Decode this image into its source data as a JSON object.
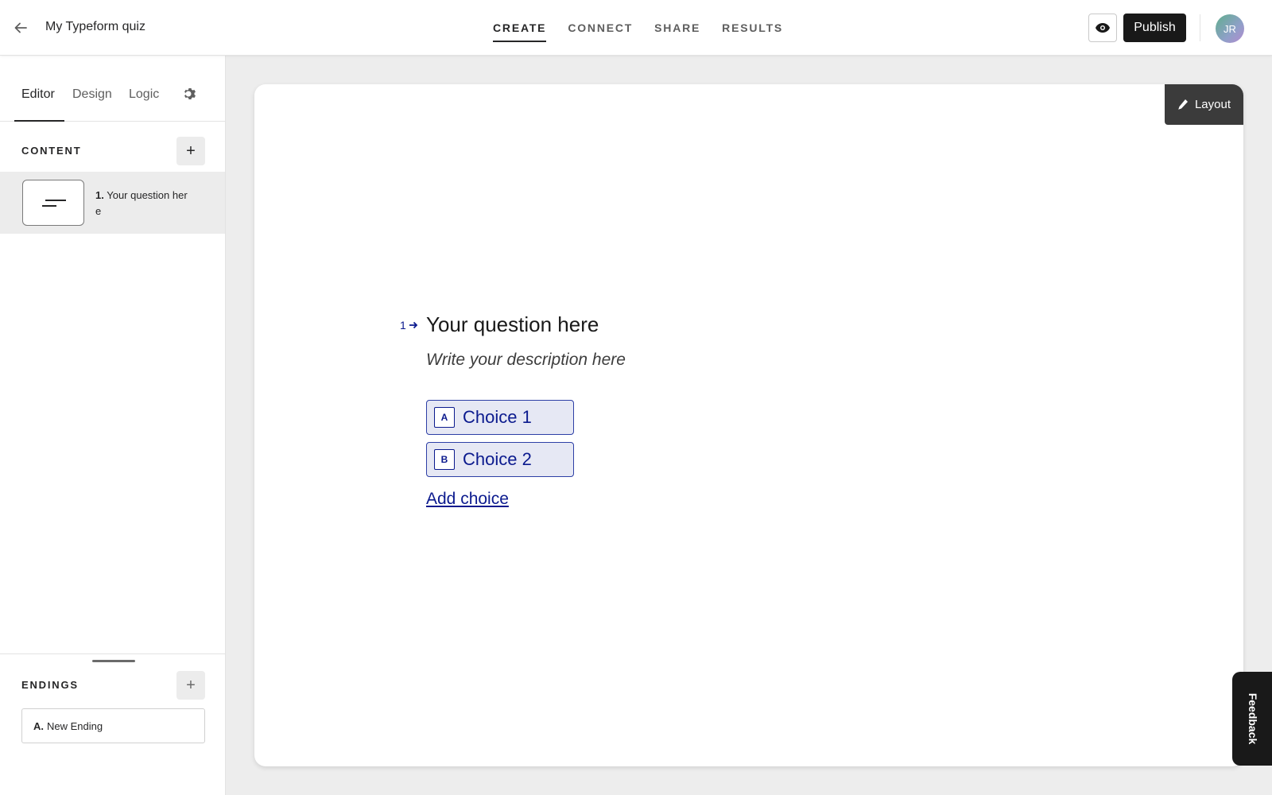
{
  "header": {
    "form_title": "My Typeform quiz",
    "tabs": [
      {
        "label": "CREATE",
        "active": true
      },
      {
        "label": "CONNECT",
        "active": false
      },
      {
        "label": "SHARE",
        "active": false
      },
      {
        "label": "RESULTS",
        "active": false
      }
    ],
    "publish_label": "Publish",
    "avatar_initials": "JR"
  },
  "sidebar": {
    "tabs": [
      {
        "label": "Editor",
        "active": true
      },
      {
        "label": "Design",
        "active": false
      },
      {
        "label": "Logic",
        "active": false
      }
    ],
    "content_label": "CONTENT",
    "questions": [
      {
        "number": "1.",
        "text": "Your question here"
      }
    ],
    "endings_label": "ENDINGS",
    "endings": [
      {
        "key": "A.",
        "label": "New Ending"
      }
    ]
  },
  "canvas": {
    "layout_label": "Layout",
    "question_number": "1",
    "question_title": "Your question here",
    "question_description": "Write your description here",
    "choices": [
      {
        "key": "A",
        "label": "Choice 1"
      },
      {
        "key": "B",
        "label": "Choice 2"
      }
    ],
    "add_choice_label": "Add choice"
  },
  "feedback_label": "Feedback",
  "colors": {
    "accent": "#0b1a8e",
    "choice_bg": "#e6e8f4",
    "publish_bg": "#191919"
  }
}
